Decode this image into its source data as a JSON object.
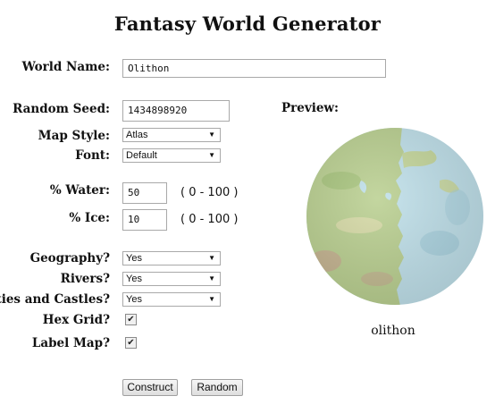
{
  "page": {
    "title": "Fantasy World Generator"
  },
  "form": {
    "world_name": {
      "label": "World Name:",
      "value": "Olithon"
    },
    "random_seed": {
      "label": "Random Seed:",
      "value": "1434898920"
    },
    "map_style": {
      "label": "Map Style:",
      "value": "Atlas"
    },
    "font": {
      "label": "Font:",
      "value": "Default"
    },
    "water": {
      "label": "% Water:",
      "value": "50",
      "range": "( 0 - 100 )"
    },
    "ice": {
      "label": "% Ice:",
      "value": "10",
      "range": "( 0 - 100 )"
    },
    "geography": {
      "label": "Geography?",
      "value": "Yes"
    },
    "rivers": {
      "label": "Rivers?",
      "value": "Yes"
    },
    "cities": {
      "label": "Cities and Castles?",
      "value": "Yes"
    },
    "hex_grid": {
      "label": "Hex Grid?",
      "checked": true
    },
    "label_map": {
      "label": "Label Map?",
      "checked": true
    }
  },
  "buttons": {
    "construct": "Construct",
    "random": "Random"
  },
  "preview": {
    "label": "Preview:",
    "world_label": "olithon"
  },
  "colors": {
    "land": "#b9cf8f",
    "ocean": "#bfe0ea",
    "mountain": "#c9a78f"
  },
  "icons": {
    "dropdown": "chevron-down-icon",
    "check": "checkmark-icon"
  }
}
